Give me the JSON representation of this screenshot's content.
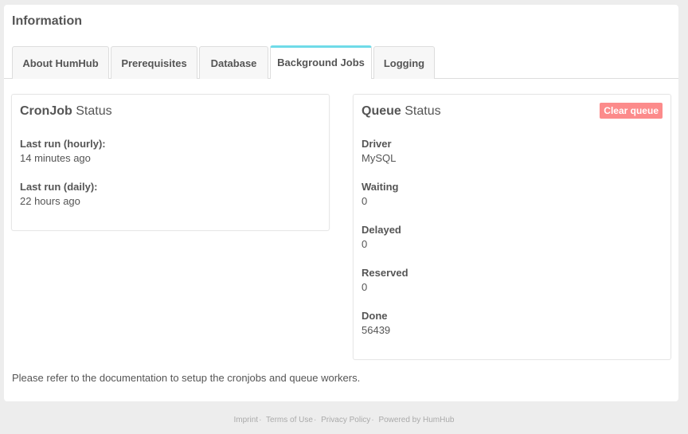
{
  "panel": {
    "title": "Information"
  },
  "tabs": [
    {
      "label": "About HumHub",
      "active": false
    },
    {
      "label": "Prerequisites",
      "active": false
    },
    {
      "label": "Database",
      "active": false
    },
    {
      "label": "Background Jobs",
      "active": true
    },
    {
      "label": "Logging",
      "active": false
    }
  ],
  "cronjob": {
    "title_bold": "CronJob",
    "title_light": "Status",
    "fields": [
      {
        "label": "Last run (hourly):",
        "value": "14 minutes ago"
      },
      {
        "label": "Last run (daily):",
        "value": "22 hours ago"
      }
    ]
  },
  "queue": {
    "title_bold": "Queue",
    "title_light": "Status",
    "clear_label": "Clear queue",
    "fields": [
      {
        "label": "Driver",
        "value": "MySQL"
      },
      {
        "label": "Waiting",
        "value": "0"
      },
      {
        "label": "Delayed",
        "value": "0"
      },
      {
        "label": "Reserved",
        "value": "0"
      },
      {
        "label": "Done",
        "value": "56439"
      }
    ]
  },
  "note": "Please refer to the documentation to setup the cronjobs and queue workers.",
  "footer": {
    "links": [
      "Imprint",
      "Terms of Use",
      "Privacy Policy",
      "Powered by HumHub"
    ],
    "separator": "·"
  },
  "colors": {
    "accent": "#6fdbe8",
    "danger": "#fc8b8b",
    "background": "#ededed"
  }
}
